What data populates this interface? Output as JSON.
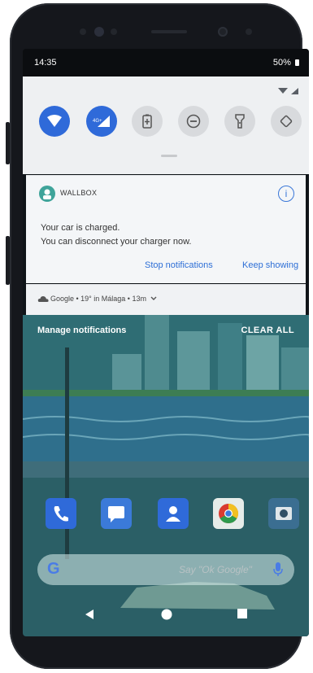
{
  "status_bar": {
    "time": "14:35",
    "battery": "50%"
  },
  "quick_settings": {
    "tiles": [
      {
        "name": "wifi",
        "state": "on",
        "label": ""
      },
      {
        "name": "mobile-data",
        "state": "on",
        "label": "4G+"
      },
      {
        "name": "battery-saver",
        "state": "off",
        "label": ""
      },
      {
        "name": "do-not-disturb",
        "state": "off",
        "label": ""
      },
      {
        "name": "flashlight",
        "state": "off",
        "label": ""
      },
      {
        "name": "auto-rotate",
        "state": "off",
        "label": ""
      }
    ]
  },
  "notification": {
    "app_name": "WALLBOX",
    "line1": "Your car is charged.",
    "line2": "You can disconnect your charger now.",
    "actions": [
      "Stop notifications",
      "Keep showing"
    ]
  },
  "weather": {
    "text": "Google • 19° in Málaga • 13m"
  },
  "shade_footer": {
    "manage": "Manage notifications",
    "clear_all": "CLEAR ALL"
  },
  "search": {
    "hint": "Say \"Ok Google\""
  },
  "colors": {
    "accent": "#2f6ad9",
    "link": "#2e6fd6",
    "wallbox": "#3fa49a"
  }
}
